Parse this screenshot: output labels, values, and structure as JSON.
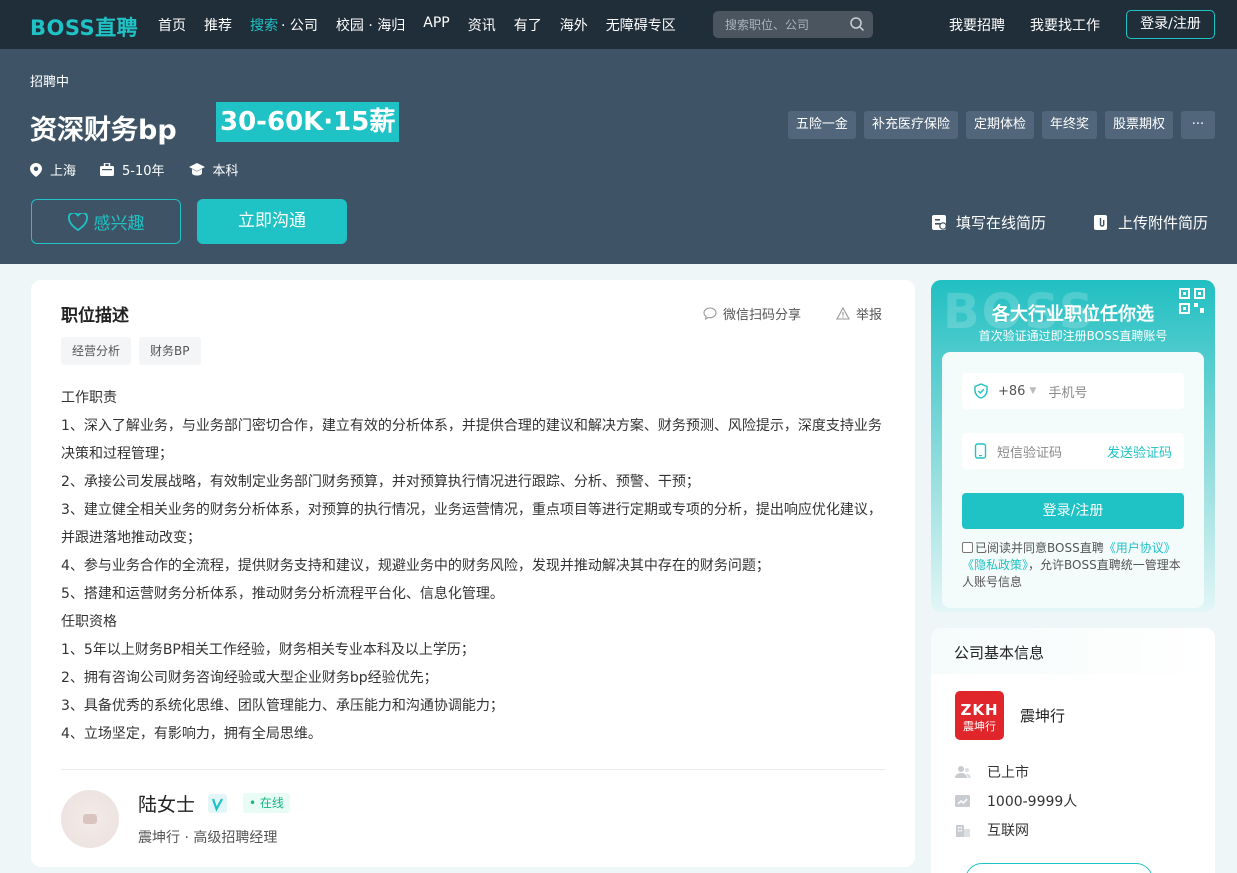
{
  "nav": {
    "logo": "BOSS直聘",
    "menu": [
      "首页",
      "推荐"
    ],
    "menu_search": "搜索",
    "menu_company": "· 公司",
    "menu_rest": [
      "校园 · 海归",
      "APP",
      "资讯",
      "有了",
      "海外",
      "无障碍专区"
    ],
    "search_placeholder": "搜索职位、公司",
    "recruit": "我要招聘",
    "find_job": "我要找工作",
    "login": "登录/注册"
  },
  "job": {
    "status": "招聘中",
    "title": "资深财务bp",
    "salary": "30-60K·15薪",
    "benefits": [
      "五险一金",
      "补充医疗保险",
      "定期体检",
      "年终奖",
      "股票期权",
      "···"
    ],
    "city": "上海",
    "experience": "5-10年",
    "degree": "本科",
    "interested": "感兴趣",
    "chat": "立即沟通",
    "online_resume": "填写在线简历",
    "upload_resume": "上传附件简历"
  },
  "description": {
    "title": "职位描述",
    "share": "微信扫码分享",
    "report": "举报",
    "keywords": [
      "经营分析",
      "财务BP"
    ],
    "lines": [
      "工作职责",
      "1、深入了解业务，与业务部门密切合作，建立有效的分析体系，并提供合理的建议和解决方案、财务预测、风险提示，深度支持业务决策和过程管理；",
      "2、承接公司发展战略，有效制定业务部门财务预算，并对预算执行情况进行跟踪、分析、预警、干预；",
      "3、建立健全相关业务的财务分析体系，对预算的执行情况，业务运营情况，重点项目等进行定期或专项的分析，提出响应优化建议，并跟进落地推动改变；",
      "4、参与业务合作的全流程，提供财务支持和建议，规避业务中的财务风险，发现并推动解决其中存在的财务问题；",
      "5、搭建和运营财务分析体系，推动财务分析流程平台化、信息化管理。",
      "任职资格",
      "1、5年以上财务BP相关工作经验，财务相关专业本科及以上学历；",
      "2、拥有咨询公司财务咨询经验或大型企业财务bp经验优先；",
      "3、具备优秀的系统化思维、团队管理能力、承压能力和沟通协调能力；",
      "4、立场坚定，有影响力，拥有全局思维。"
    ]
  },
  "recruiter": {
    "name": "陆女士",
    "status": "• 在线",
    "subtitle": "震坤行 · 高级招聘经理"
  },
  "login_card": {
    "watermark": "BOSS",
    "title": "各大行业职位任你选",
    "subtitle": "首次验证通过即注册BOSS直聘账号",
    "country_code": "+86",
    "phone_placeholder": "手机号",
    "code_placeholder": "短信验证码",
    "send_code": "发送验证码",
    "submit": "登录/注册",
    "agree_prefix": "已阅读并同意BOSS直聘",
    "user_agreement": "《用户协议》",
    "privacy": "《隐私政策》",
    "agree_suffix": "，允许BOSS直聘统一管理本人账号信息"
  },
  "company": {
    "section_title": "公司基本信息",
    "logo_text": "ZKH",
    "logo_sub": "震坤行",
    "name": "震坤行",
    "stage": "已上市",
    "size": "1000-9999人",
    "industry": "互联网"
  },
  "colors": {
    "accent": "#1fc2c5",
    "nav_bg": "#202e3a",
    "header_bg": "#3e5466",
    "company_logo": "#e0262b"
  }
}
